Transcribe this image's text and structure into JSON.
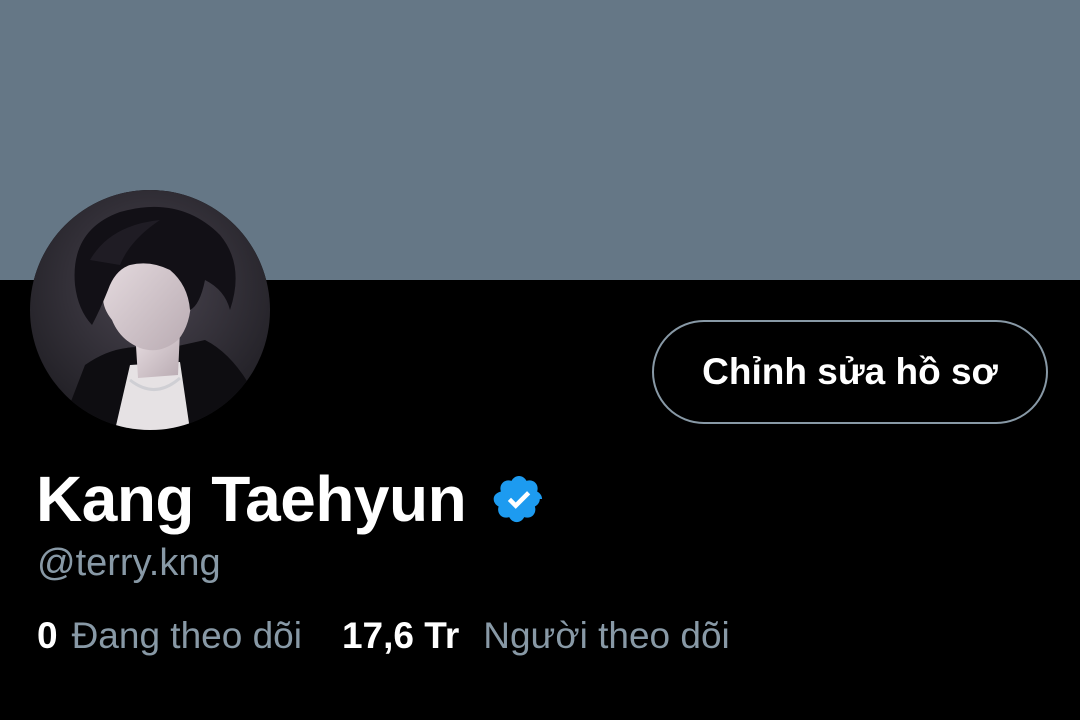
{
  "profile": {
    "display_name": "Kang Taehyun",
    "handle": "@terry.kng",
    "verified_icon": "verified-badge-icon",
    "edit_button_label": "Chỉnh sửa hồ sơ"
  },
  "stats": {
    "following_count": "0",
    "following_label": "Đang theo dõi",
    "followers_count": "17,6 Tr",
    "followers_label": "Người theo dõi"
  },
  "colors": {
    "banner": "#657786",
    "background": "#000000",
    "muted_text": "#8899a6",
    "verified_blue": "#1d9bf0"
  }
}
